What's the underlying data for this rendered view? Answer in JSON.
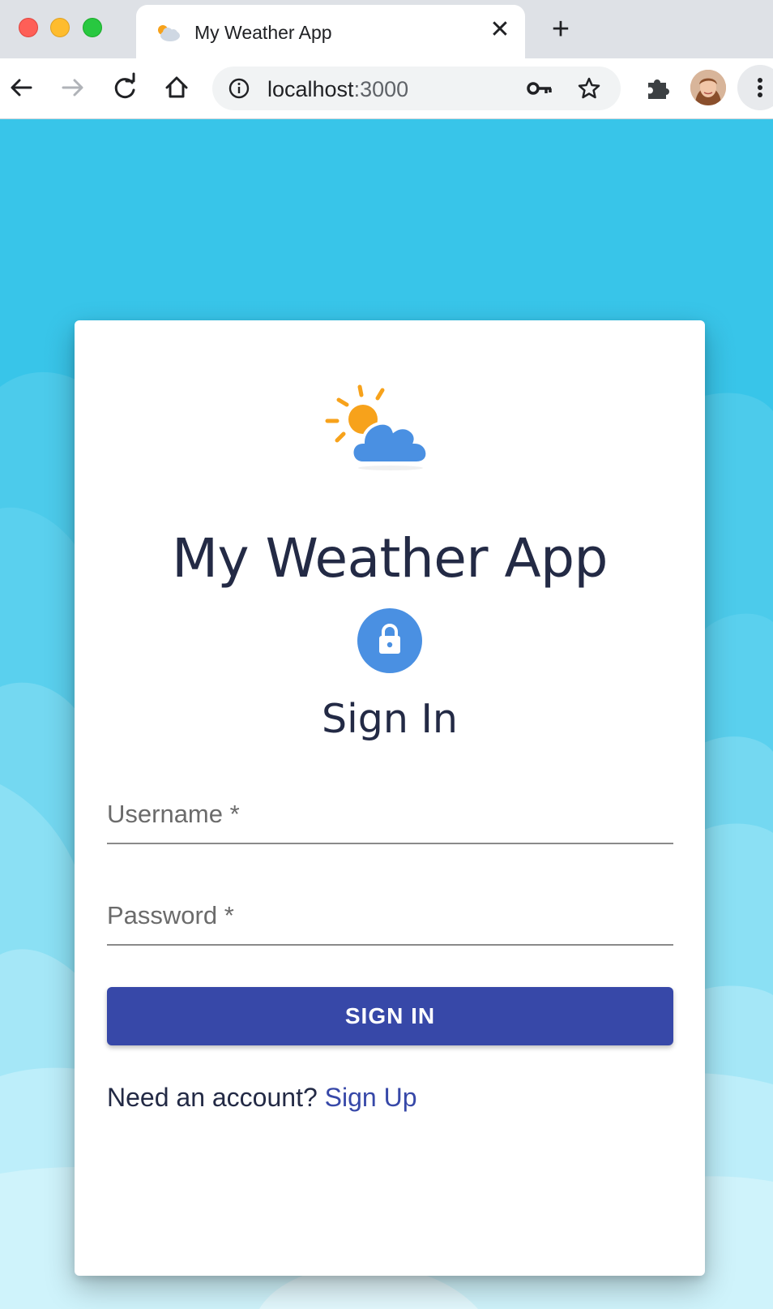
{
  "browser": {
    "tab_title": "My Weather App",
    "tab_close_label": "✕",
    "new_tab_label": "+",
    "url_host": "localhost",
    "url_port": ":3000"
  },
  "card": {
    "app_title": "My Weather App",
    "signin_title": "Sign In",
    "username_placeholder": "Username *",
    "password_placeholder": "Password *",
    "signin_button": "SIGN IN",
    "need_account_text": "Need an account?",
    "signup_link": "Sign Up"
  },
  "colors": {
    "background_sky": "#38c5e9",
    "card_bg": "#ffffff",
    "title_text": "#232a45",
    "lock_circle": "#4a90e2",
    "primary_button": "#3748a8",
    "sun": "#f7a21b",
    "cloud": "#4a90e2"
  },
  "icons": {
    "logo": "sun-cloud-icon",
    "lock": "lock-icon",
    "back": "back-arrow-icon",
    "forward": "forward-arrow-icon",
    "reload": "reload-icon",
    "home": "home-icon",
    "info": "info-icon",
    "key": "key-icon",
    "star": "star-icon",
    "extensions": "puzzle-icon",
    "menu": "kebab-menu-icon"
  }
}
